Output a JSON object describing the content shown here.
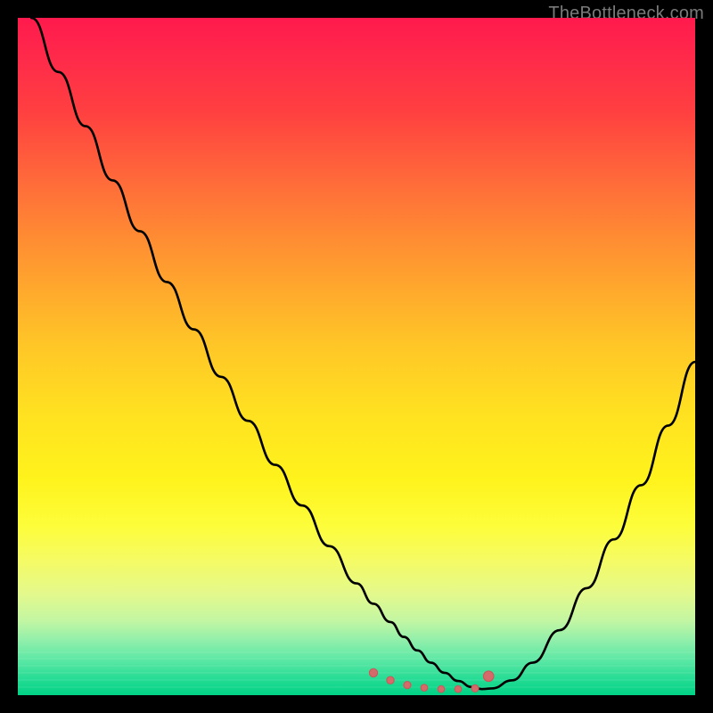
{
  "watermark": {
    "text": "TheBottleneck.com"
  },
  "colors": {
    "curve": "#000000",
    "dots": "#d46a6a",
    "dots_stroke": "#c55b5b"
  },
  "chart_data": {
    "type": "line",
    "title": "",
    "xlabel": "",
    "ylabel": "",
    "xlim": [
      0,
      100
    ],
    "ylim": [
      0,
      100
    ],
    "grid": false,
    "legend": false,
    "series": [
      {
        "name": "bottleneck-curve",
        "x": [
          2,
          6,
          10,
          14,
          18,
          22,
          26,
          30,
          34,
          38,
          42,
          46,
          50,
          52.5,
          55,
          57,
          59,
          61,
          63,
          65,
          67,
          68.5,
          70,
          73,
          76,
          80,
          84,
          88,
          92,
          96,
          100
        ],
        "y": [
          100,
          92,
          84,
          76,
          68.5,
          61,
          54,
          47,
          40.5,
          34,
          28,
          22,
          16.5,
          13.5,
          10.8,
          8.6,
          6.6,
          4.8,
          3.3,
          2.1,
          1.2,
          0.9,
          1.0,
          2.2,
          4.8,
          9.6,
          15.8,
          23.0,
          31.0,
          39.8,
          49.2
        ]
      }
    ],
    "dots": {
      "name": "floor-dots",
      "x": [
        52.5,
        55.0,
        57.5,
        60.0,
        62.5,
        65.0,
        67.5,
        69.5
      ],
      "y": [
        3.3,
        2.2,
        1.5,
        1.1,
        0.9,
        0.9,
        1.0,
        2.8
      ],
      "r": [
        4.6,
        4.2,
        4.0,
        3.8,
        3.8,
        3.8,
        4.0,
        5.8
      ]
    }
  }
}
